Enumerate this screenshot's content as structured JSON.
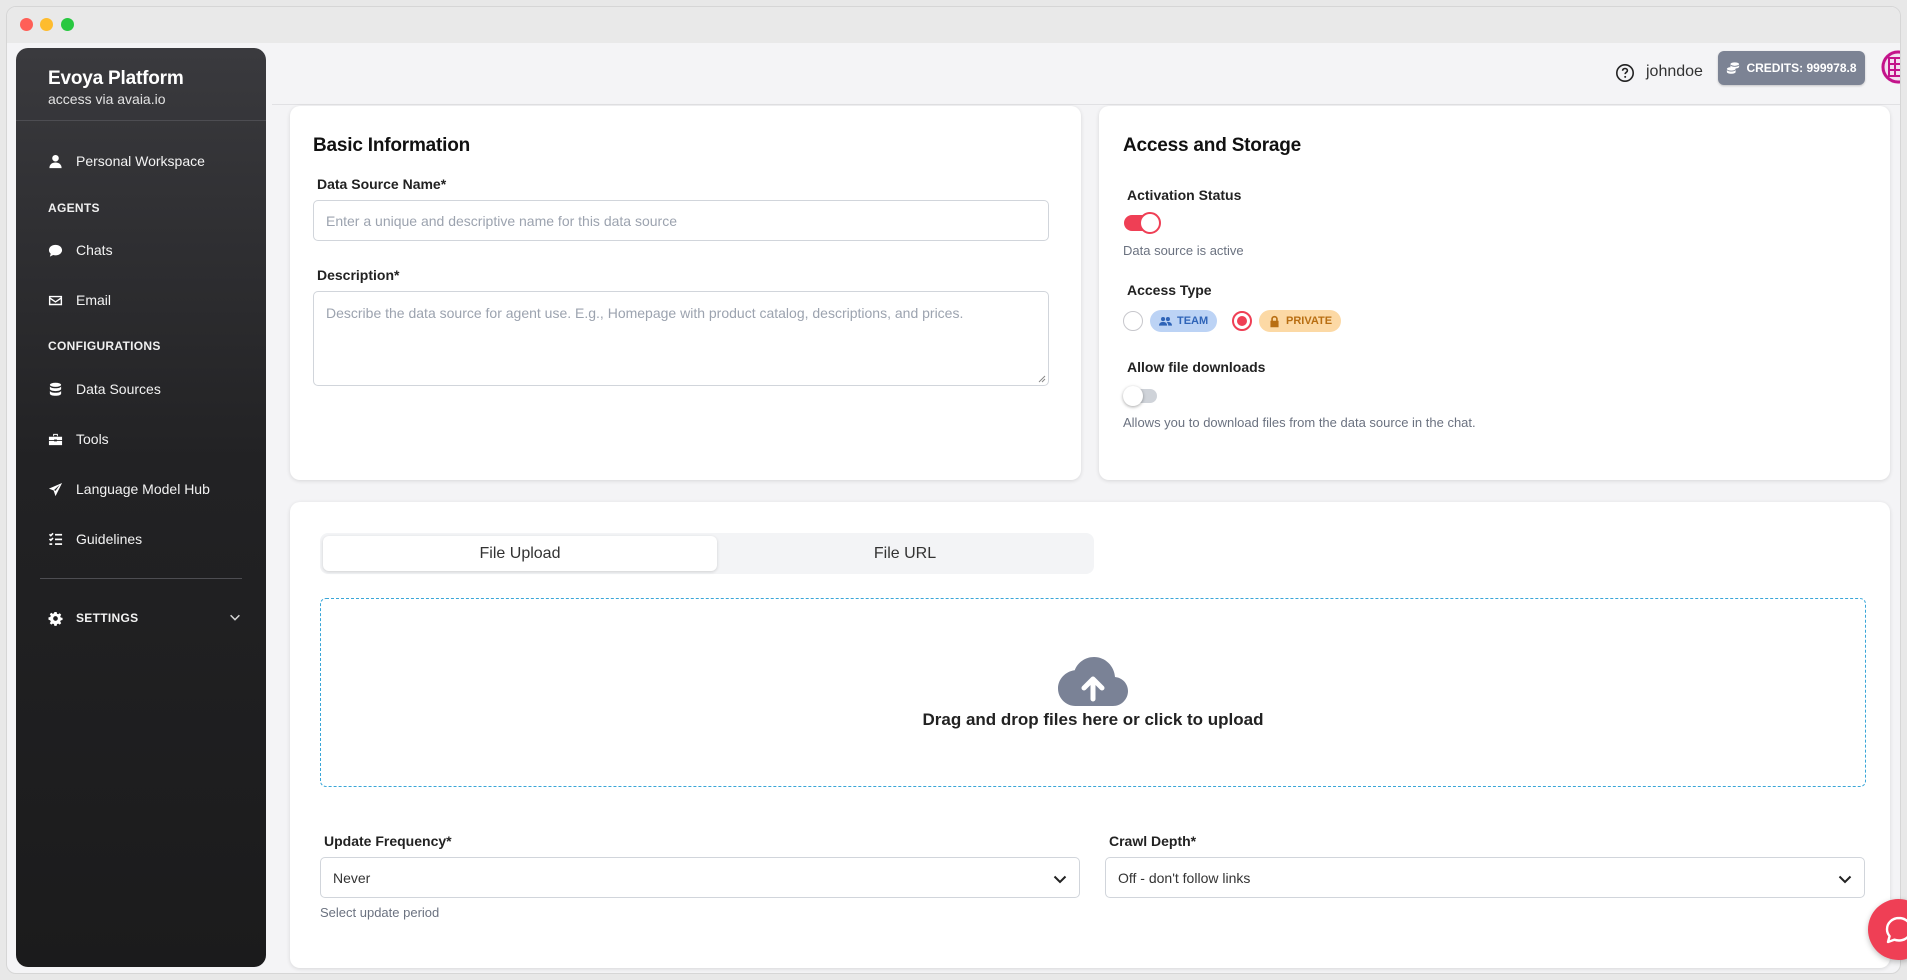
{
  "brand": {
    "title": "Evoya Platform",
    "subtitle": "access via avaia.io"
  },
  "sidebar": {
    "items": [
      {
        "label": "Personal Workspace",
        "icon": "user-icon"
      },
      {
        "label": "Chats",
        "icon": "chat-icon"
      },
      {
        "label": "Email",
        "icon": "mail-icon"
      },
      {
        "label": "Data Sources",
        "icon": "database-icon"
      },
      {
        "label": "Tools",
        "icon": "toolbox-icon"
      },
      {
        "label": "Language Model Hub",
        "icon": "paper-plane-icon"
      },
      {
        "label": "Guidelines",
        "icon": "checklist-icon"
      }
    ],
    "sections": {
      "agents": "AGENTS",
      "configurations": "CONFIGURATIONS"
    },
    "settings_label": "SETTINGS"
  },
  "header": {
    "username": "johndoe",
    "credits": "CREDITS: 999978.8"
  },
  "basic_info": {
    "title": "Basic Information",
    "name_label": "Data Source Name*",
    "name_placeholder": "Enter a unique and descriptive name for this data source",
    "description_label": "Description*",
    "description_placeholder": "Describe the data source for agent use. E.g., Homepage with product catalog, descriptions, and prices."
  },
  "access": {
    "title": "Access and Storage",
    "activation_label": "Activation Status",
    "activation_state": true,
    "activation_helper": "Data source is active",
    "access_type_label": "Access Type",
    "team_label": "TEAM",
    "private_label": "PRIVATE",
    "selected_access": "PRIVATE",
    "downloads_label": "Allow file downloads",
    "downloads_state": false,
    "downloads_helper": "Allows you to download files from the data source in the chat."
  },
  "upload": {
    "tabs": [
      "File Upload",
      "File URL"
    ],
    "active_tab": "File Upload",
    "drop_text": "Drag and drop files here or click to upload"
  },
  "settings": {
    "frequency_label": "Update Frequency*",
    "frequency_value": "Never",
    "frequency_helper": "Select update period",
    "depth_label": "Crawl Depth*",
    "depth_value": "Off - don't follow links"
  },
  "colors": {
    "accent": "#ef3f55",
    "sidebar": "#222224",
    "credits_bg": "#7c8394",
    "dropzone_border": "#3aa6d8"
  }
}
